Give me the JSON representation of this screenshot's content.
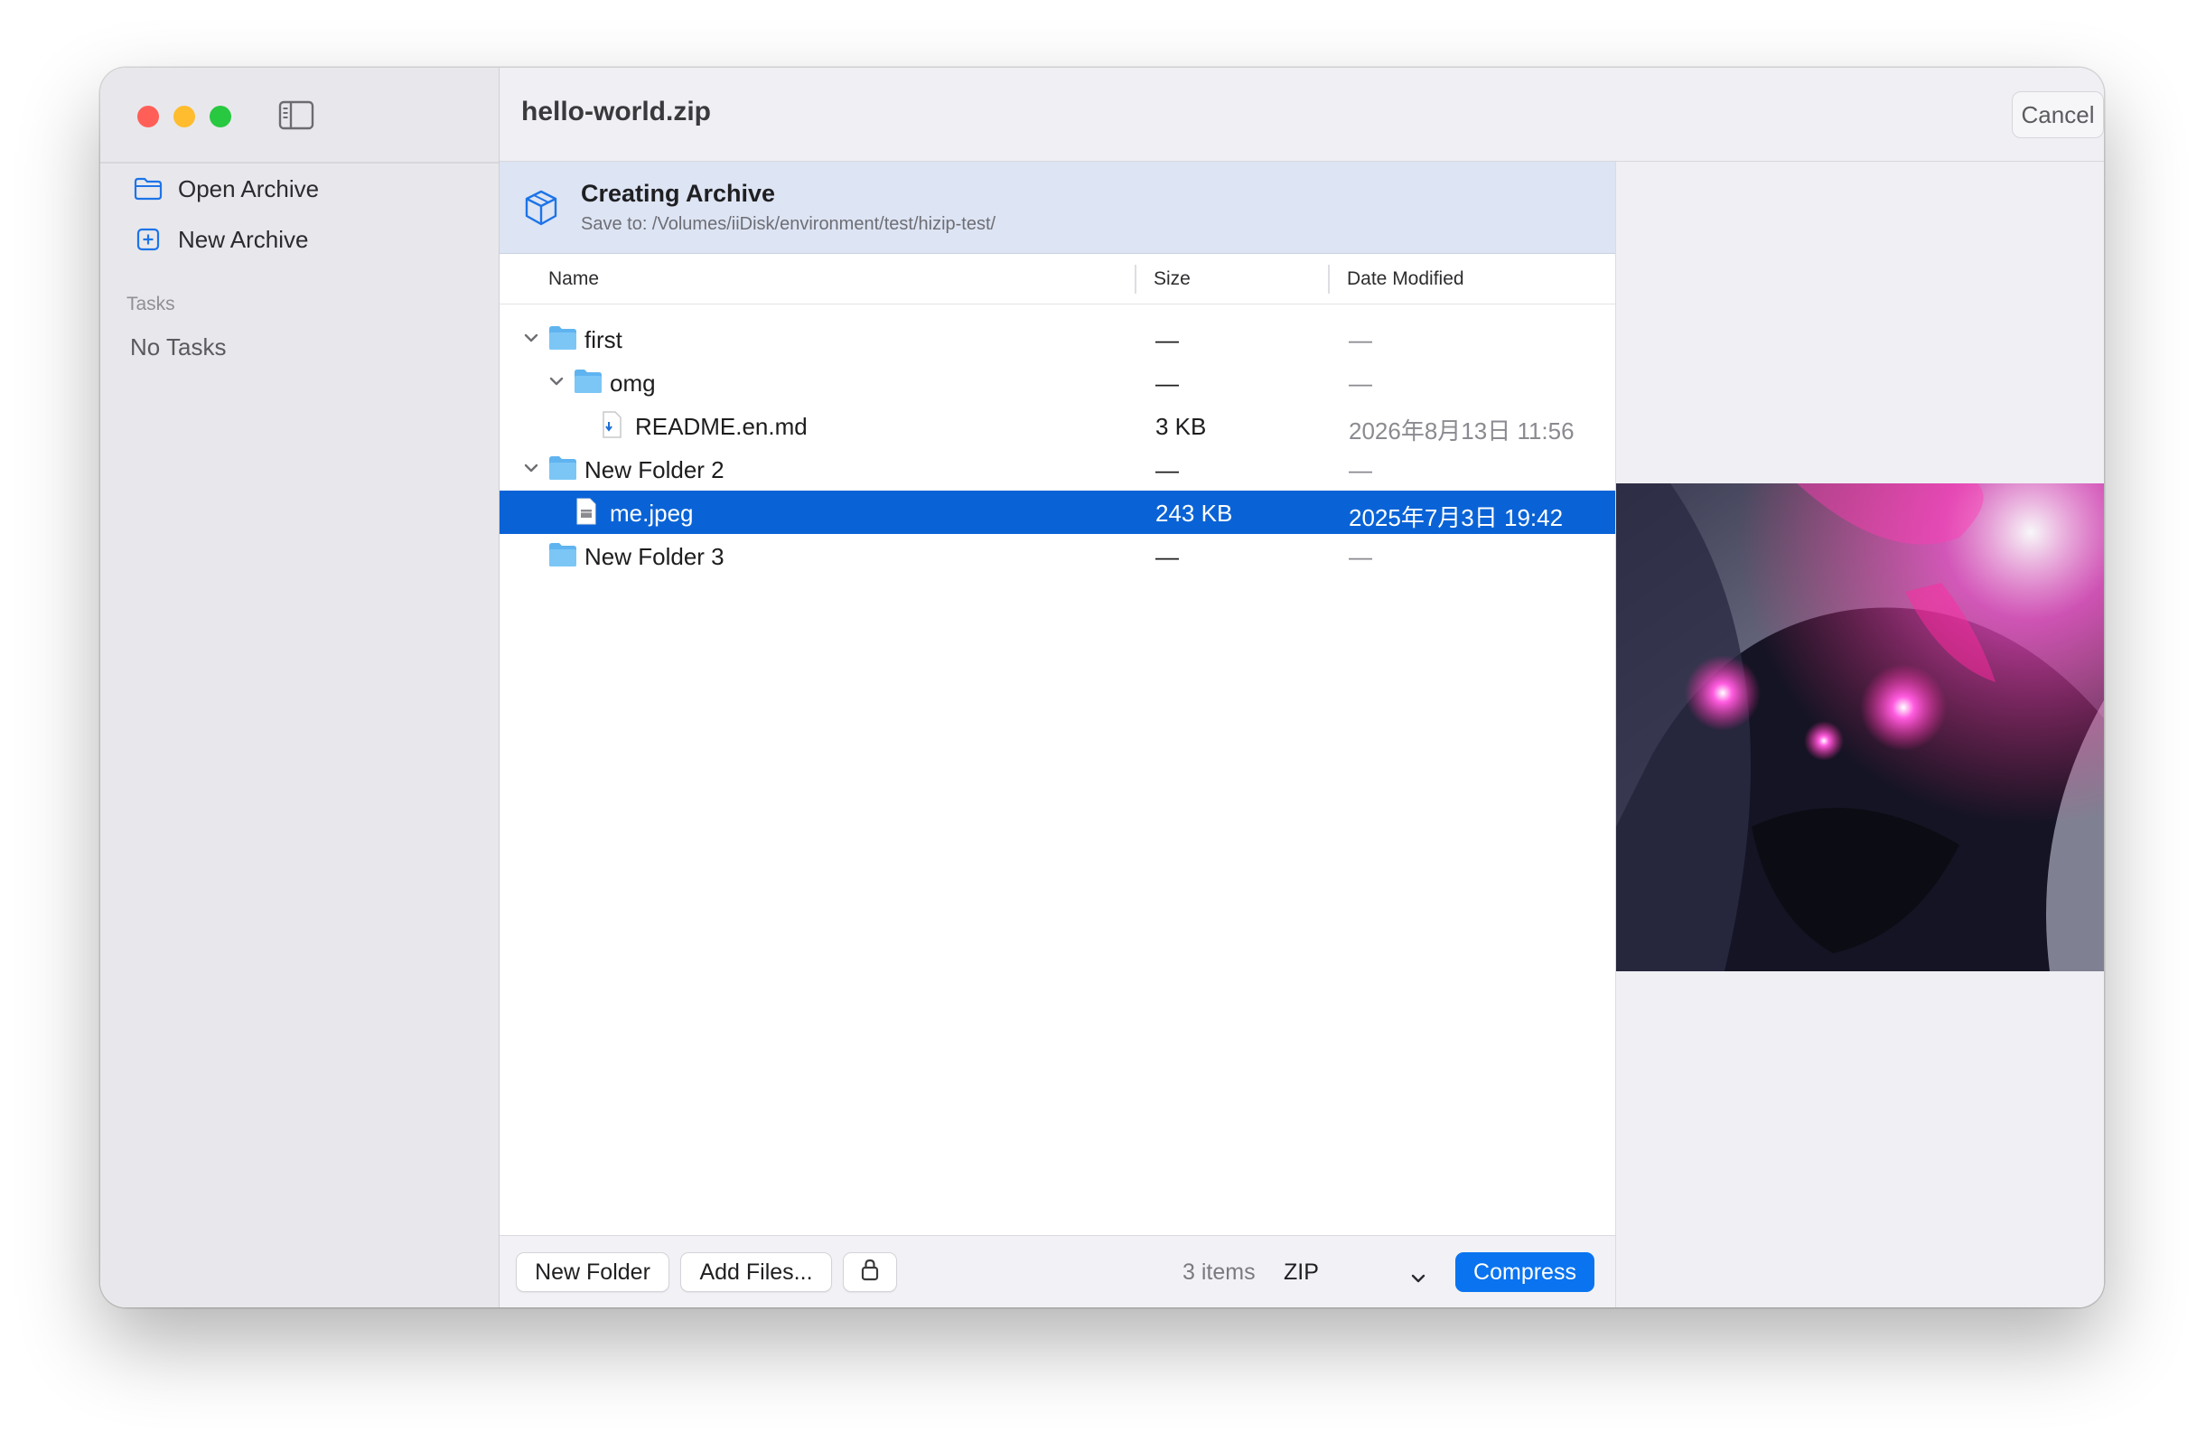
{
  "window": {
    "title": "hello-world.zip",
    "cancel_label": "Cancel"
  },
  "sidebar": {
    "items": [
      {
        "label": "Open Archive",
        "icon": "folder-icon"
      },
      {
        "label": "New Archive",
        "icon": "plus-square-icon"
      }
    ],
    "tasks_heading": "Tasks",
    "tasks_empty": "No Tasks"
  },
  "banner": {
    "title": "Creating Archive",
    "subtitle": "Save to: /Volumes/iiDisk/environment/test/hizip-test/",
    "icon": "box-icon"
  },
  "columns": {
    "name": "Name",
    "size": "Size",
    "date": "Date Modified"
  },
  "files": [
    {
      "name": "first",
      "size": "—",
      "date": "—",
      "kind": "folder",
      "expanded": true
    },
    {
      "name": "omg",
      "size": "—",
      "date": "—",
      "kind": "folder",
      "expanded": true
    },
    {
      "name": "README.en.md",
      "size": "3 KB",
      "date": "2026年8月13日 11:56",
      "kind": "markdown-file"
    },
    {
      "name": "New Folder 2",
      "size": "—",
      "date": "—",
      "kind": "folder",
      "expanded": true
    },
    {
      "name": "me.jpeg",
      "size": "243 KB",
      "date": "2025年7月3日 19:42",
      "kind": "image-file",
      "selected": true
    },
    {
      "name": "New Folder 3",
      "size": "—",
      "date": "—",
      "kind": "folder",
      "expanded": false
    }
  ],
  "footer": {
    "new_folder_label": "New Folder",
    "add_files_label": "Add Files...",
    "lock_icon": "lock-icon",
    "items_count": "3 items",
    "format_value": "ZIP",
    "compress_label": "Compress"
  },
  "colors": {
    "accent": "#0a74f0",
    "selection": "#0a63d6",
    "folder": "#5fb4f0",
    "banner_bg": "#dde4f3"
  }
}
